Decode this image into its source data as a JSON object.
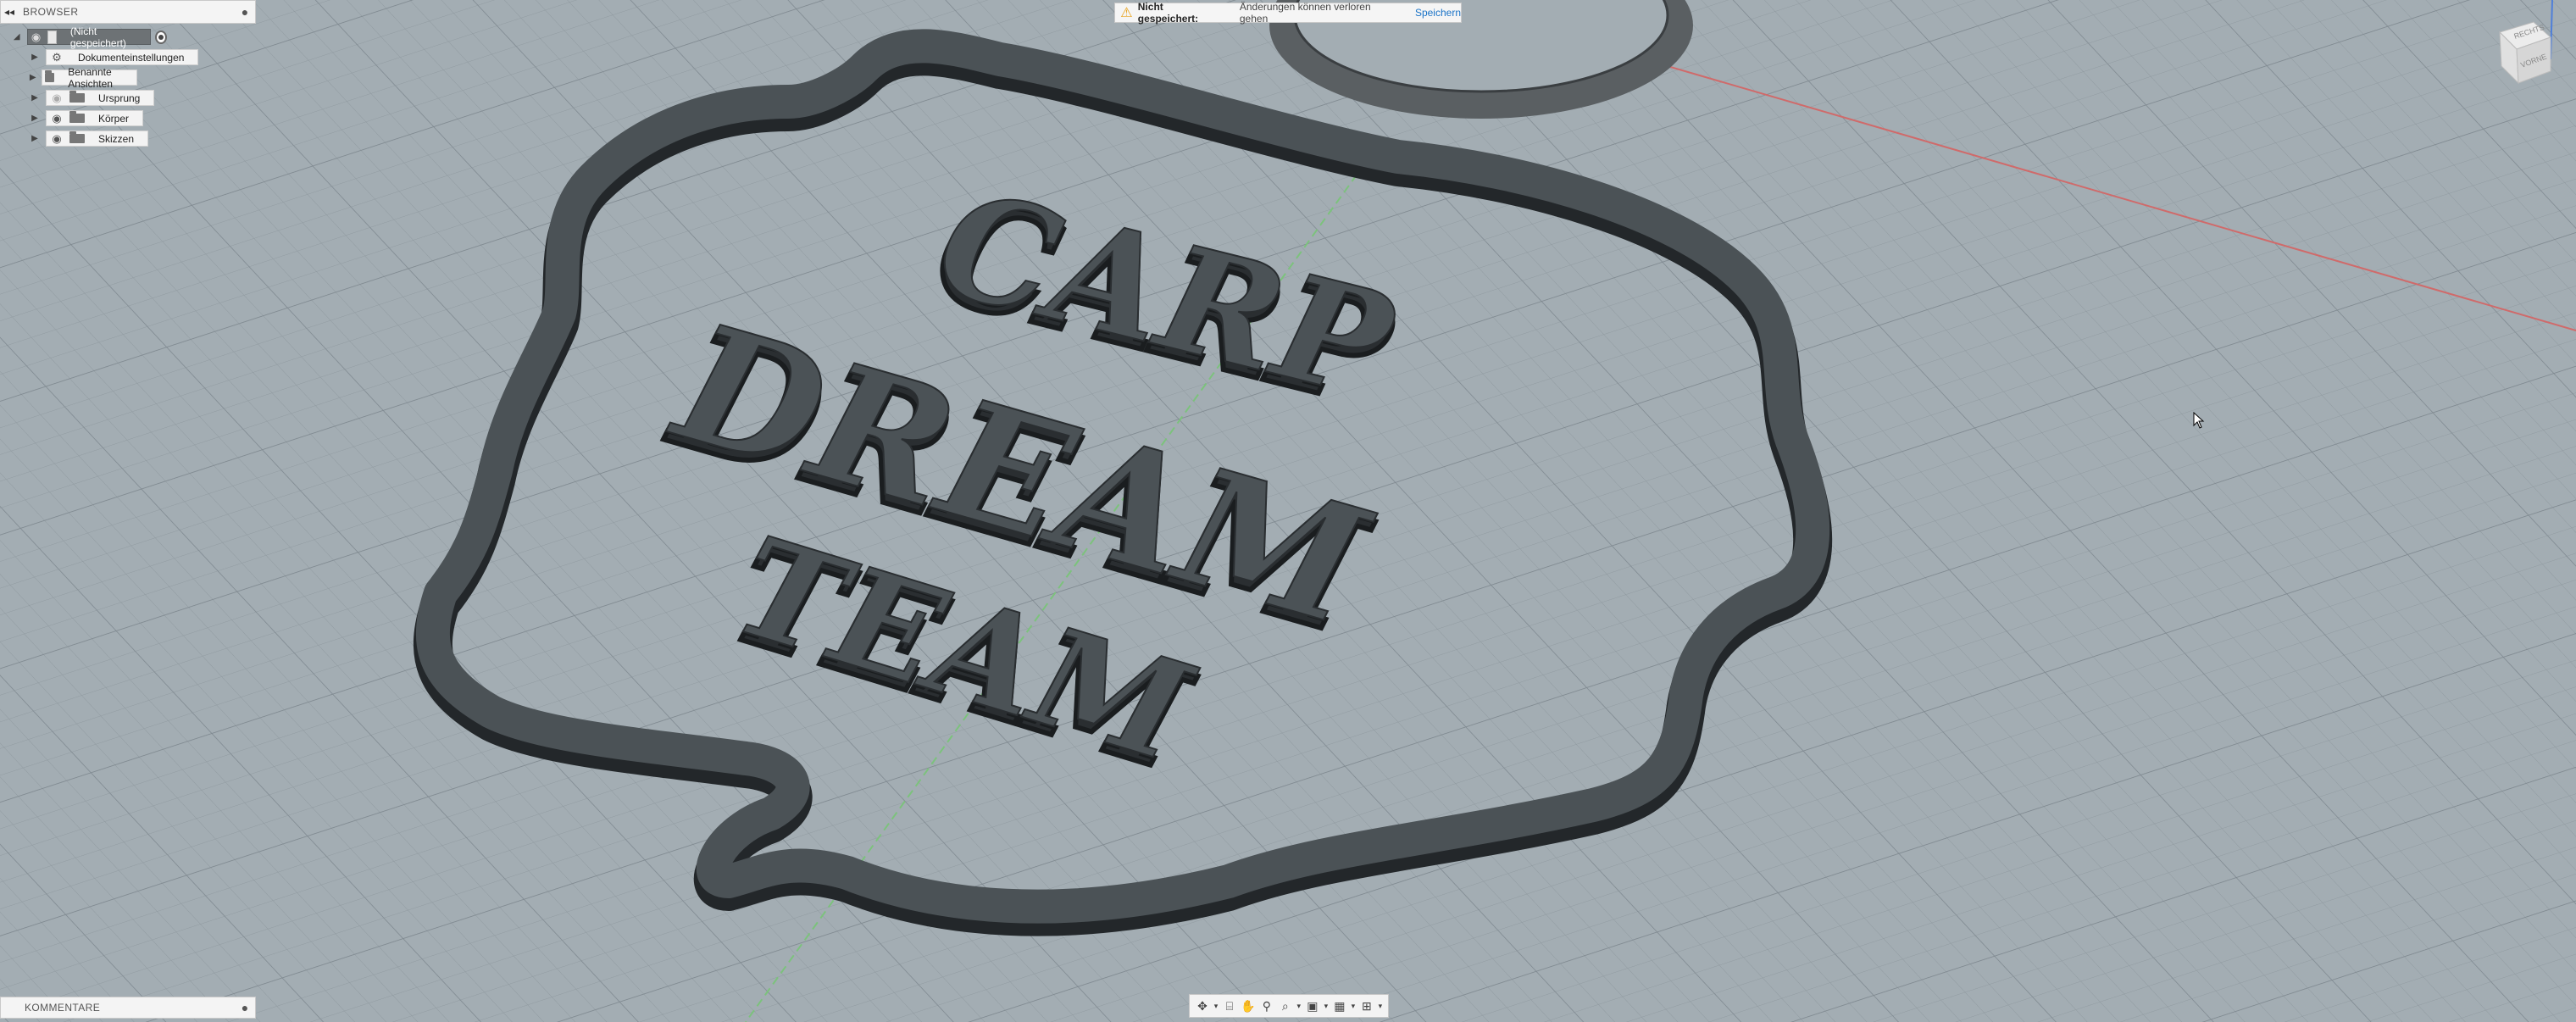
{
  "browser": {
    "title": "BROWSER",
    "root": {
      "label": "(Nicht gespeichert)"
    },
    "items": [
      {
        "label": "Dokumenteinstellungen",
        "icon": "gear-icon"
      },
      {
        "label": "Benannte Ansichten",
        "icon": "folder-icon"
      },
      {
        "label": "Ursprung",
        "icon": "folder-icon",
        "visible": false
      },
      {
        "label": "Körper",
        "icon": "folder-icon",
        "visible": true
      },
      {
        "label": "Skizzen",
        "icon": "folder-icon",
        "visible": true
      }
    ]
  },
  "warning": {
    "title": "Nicht gespeichert:",
    "message": "Änderungen können verloren gehen",
    "action": "Speichern"
  },
  "comments": {
    "title": "KOMMENTARE"
  },
  "model": {
    "lines": [
      "CARP",
      "DREAM",
      "TEAM"
    ]
  },
  "viewcube": {
    "top": "RECHTS",
    "side": "VORNE"
  },
  "colors": {
    "grid_bg": "#9fa9af",
    "model": "#4b5256",
    "model_edge": "#2a2e31",
    "accent": "#1a73c7",
    "warning": "#e8a21c"
  }
}
